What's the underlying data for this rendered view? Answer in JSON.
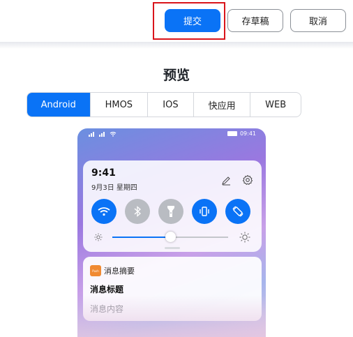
{
  "toolbar": {
    "submit_label": "提交",
    "draft_label": "存草稿",
    "cancel_label": "取消"
  },
  "preview": {
    "title": "预览",
    "tabs": [
      {
        "label": "Android",
        "active": true
      },
      {
        "label": "HMOS",
        "active": false
      },
      {
        "label": "IOS",
        "active": false
      },
      {
        "label": "快应用",
        "active": false
      },
      {
        "label": "WEB",
        "active": false
      }
    ]
  },
  "phone": {
    "status_time": "09:41",
    "status_icons": [
      "signal-icon",
      "signal-icon",
      "wifi-icon",
      "battery-icon"
    ],
    "quick_settings": {
      "time": "9:41",
      "date": "9月3日 星期四",
      "toggles": [
        {
          "icon": "wifi-icon",
          "on": true
        },
        {
          "icon": "bluetooth-icon",
          "on": false
        },
        {
          "icon": "flashlight-icon",
          "on": false
        },
        {
          "icon": "vibrate-icon",
          "on": true
        },
        {
          "icon": "rotate-icon",
          "on": true
        }
      ],
      "brightness_level": 0.5
    },
    "notification": {
      "app_icon_text": "Push",
      "app_name": "消息摘要",
      "title": "消息标题",
      "content": "消息内容"
    }
  },
  "colors": {
    "accent": "#0a73f6",
    "highlight": "#d9141b"
  }
}
